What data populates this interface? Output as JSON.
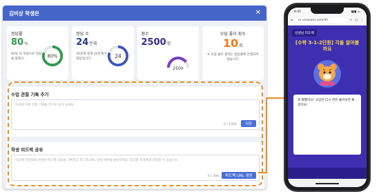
{
  "modal": {
    "title": "김비상 학생은",
    "close_glyph": "✕",
    "header_color": "#4565c8"
  },
  "cards": [
    {
      "title": "정답률",
      "value": "80",
      "unit": "%",
      "desc": "80% 의 적중으로 정답을 맞혔고,",
      "chart_label": "80%",
      "percent": 80,
      "color": "#2f9b4a"
    },
    {
      "title": "정답 수",
      "value": "24",
      "unit": "문제",
      "desc": "30문제 중에 24문제가 정답입니다.",
      "chart_label": "24",
      "fraction": 0.8,
      "color": "#3b55c2"
    },
    {
      "title": "점수",
      "value": "2500",
      "unit": "점",
      "chart_label": "2500",
      "fraction": 0.8,
      "color": "#7a3cc9"
    },
    {
      "title": "오답 풀이 횟수",
      "value": "10",
      "unit": "회",
      "desc": "※ 오답 풀이 결과는 정답률에 반영되지 않습니다."
    }
  ],
  "record_section": {
    "title": "수업 관찰 기록 추가",
    "placeholder": "이곳에 수업 관찰 기록을 추가로 남겨 보세요.",
    "counter": "0 / 1000",
    "save_label": "저장"
  },
  "share_section": {
    "title": "학생 피드백 공유",
    "placeholder": "이곳에 학생에게 전달할 피드백 내용을 기록하고 피드백 URL 생성 버튼을 클릭하세요. 링크를 학생에게 전달할 수 있습니다.",
    "counter": "0 / 300",
    "generate_label": "피드백 URL 생성"
  },
  "phone": {
    "time": "9:41",
    "url": "m.vivasam.com/#/",
    "badge": "선생님 피드백",
    "title": "[수학 3-1-2단원] 각을 알아볼까요",
    "note": "잘 했했어요! 오답은 다시 한번 풀어보면 좋겠어요!"
  },
  "colors": {
    "accent": "#4a6fd8",
    "highlight_dashed": "#f08c24",
    "app_bg": "#3d2fb0",
    "app_title": "#ffd84a"
  }
}
